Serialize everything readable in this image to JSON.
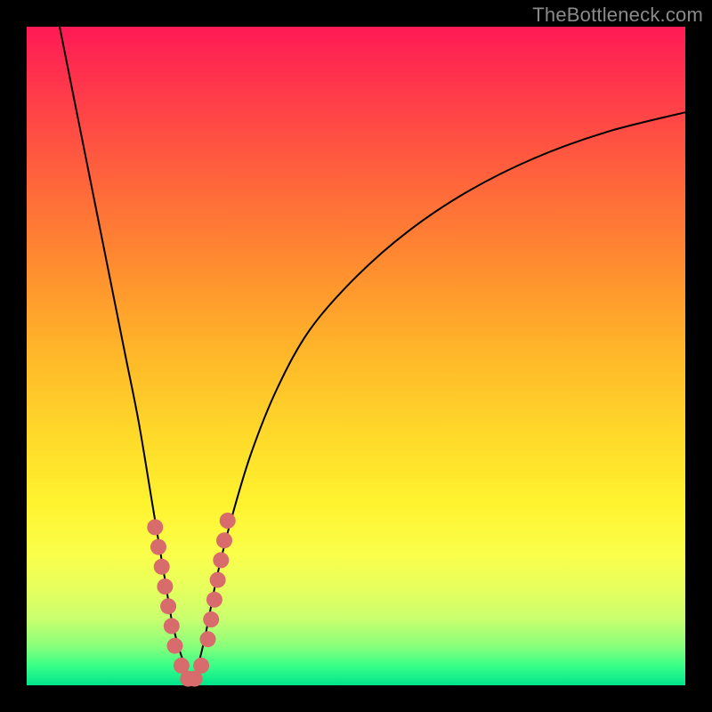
{
  "watermark": "TheBottleneck.com",
  "colors": {
    "frame": "#000000",
    "curve": "#000000",
    "dot": "#d86b6b",
    "gradient_top": "#ff1a55",
    "gradient_bottom": "#00e58c"
  },
  "chart_data": {
    "type": "line",
    "title": "",
    "xlabel": "",
    "ylabel": "",
    "xlim": [
      0,
      100
    ],
    "ylim": [
      0,
      100
    ],
    "series": [
      {
        "name": "left-curve",
        "x": [
          5,
          7,
          9,
          11,
          13,
          15,
          17,
          19,
          20,
          21,
          22,
          23,
          24,
          25
        ],
        "y": [
          100,
          90,
          80,
          70,
          60,
          50,
          40,
          28,
          22,
          16,
          10,
          6,
          3,
          0
        ]
      },
      {
        "name": "right-curve",
        "x": [
          25,
          26,
          27,
          28,
          29,
          31,
          34,
          38,
          43,
          50,
          58,
          67,
          77,
          88,
          100
        ],
        "y": [
          0,
          3,
          7,
          12,
          17,
          25,
          35,
          45,
          54,
          62,
          69,
          75,
          80,
          84,
          87
        ]
      }
    ],
    "annotations": {
      "dots_x": [
        19.5,
        20.0,
        20.5,
        21.0,
        21.5,
        22.0,
        22.5,
        23.5,
        24.5,
        25.5,
        26.5,
        27.5,
        28.0,
        28.5,
        29.0,
        29.5,
        30.0,
        30.5
      ],
      "dots_y": [
        24,
        21,
        18,
        15,
        12,
        9,
        6,
        3,
        1,
        1,
        3,
        7,
        10,
        13,
        16,
        19,
        22,
        25
      ]
    }
  }
}
